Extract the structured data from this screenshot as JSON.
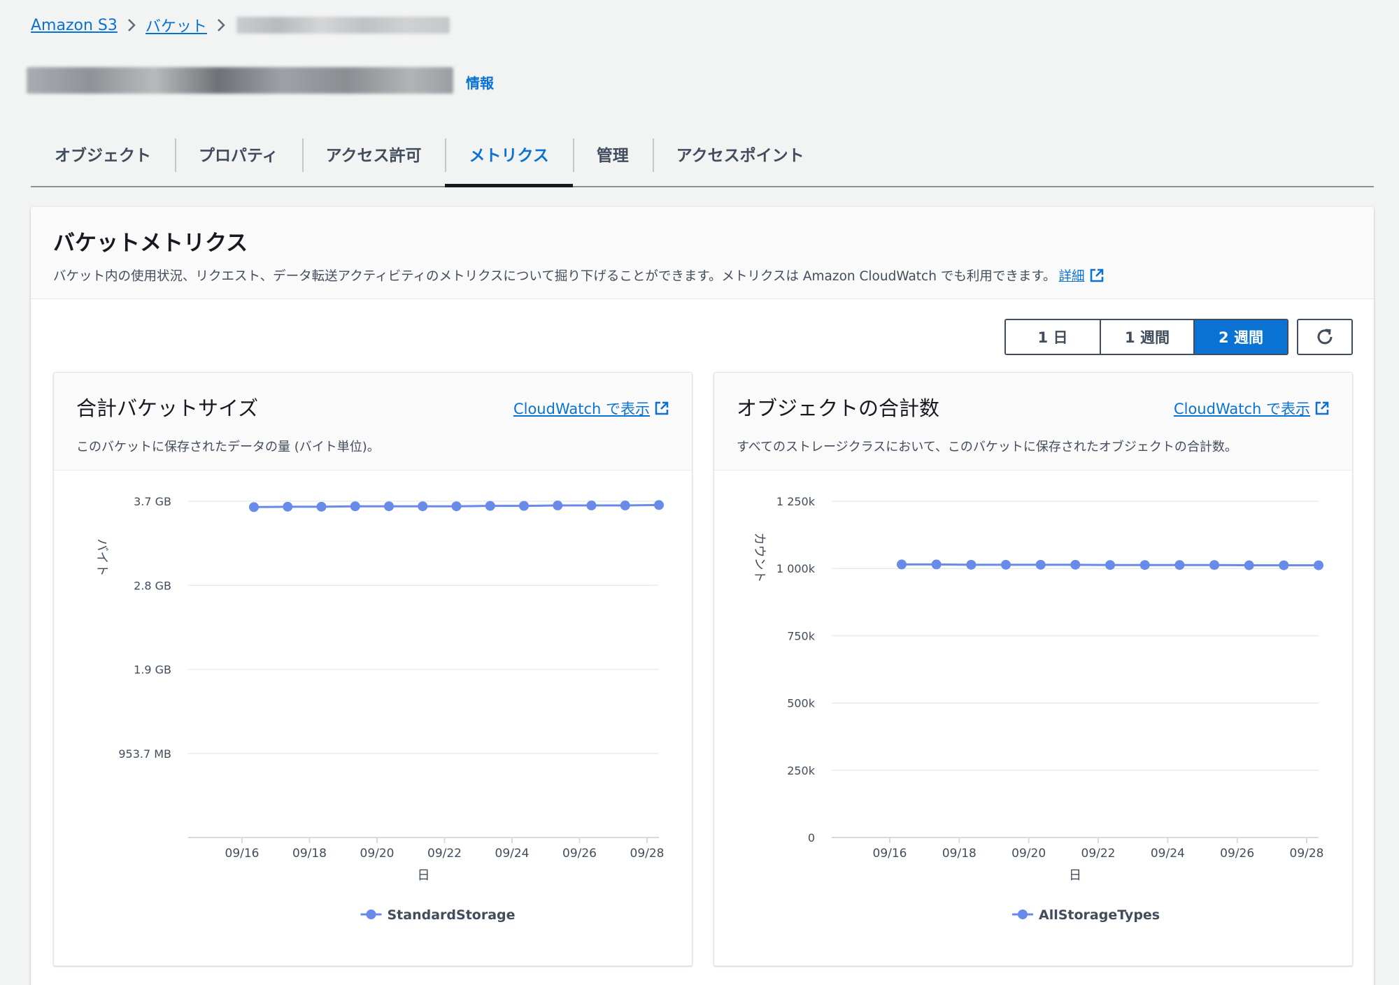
{
  "breadcrumb": {
    "root": "Amazon S3",
    "buckets": "バケット"
  },
  "header": {
    "info": "情報"
  },
  "tabs": [
    "オブジェクト",
    "プロパティ",
    "アクセス許可",
    "メトリクス",
    "管理",
    "アクセスポイント"
  ],
  "active_tab": 3,
  "section": {
    "title": "バケットメトリクス",
    "description": "バケット内の使用状況、リクエスト、データ転送アクティビティのメトリクスについて掘り下げることができます。メトリクスは Amazon CloudWatch でも利用できます。",
    "detail_link": "詳細"
  },
  "range": {
    "options": [
      "1 日",
      "1 週間",
      "2 週間"
    ],
    "selected": 2
  },
  "icons": {
    "refresh": "refresh-icon",
    "external": "external-link-icon",
    "chevron": "chevron-right-icon"
  },
  "colors": {
    "accent": "#0972d3",
    "series": "#688ae8"
  },
  "panels": {
    "left": {
      "title": "合計バケットサイズ",
      "link": "CloudWatch で表示",
      "description": "このバケットに保存されたデータの量 (バイト単位)。"
    },
    "right": {
      "title": "オブジェクトの合計数",
      "link": "CloudWatch で表示",
      "description": "すべてのストレージクラスにおいて、このバケットに保存されたオブジェクトの合計数。"
    }
  },
  "chart_data": [
    {
      "type": "line",
      "xlabel": "日",
      "ylabel": "バイト",
      "x_ticks": [
        "09/16",
        "09/18",
        "09/20",
        "09/22",
        "09/24",
        "09/26",
        "09/28"
      ],
      "y_ticks": [
        "953.7 MB",
        "1.9 GB",
        "2.8 GB",
        "3.7 GB"
      ],
      "y_tick_values": [
        1.0,
        2.0,
        3.0,
        4.0
      ],
      "ylim": [
        0,
        4.0
      ],
      "y_unit": "×10^9 bytes",
      "x": [
        "09/16",
        "09/17",
        "09/18",
        "09/19",
        "09/20",
        "09/21",
        "09/22",
        "09/23",
        "09/24",
        "09/25",
        "09/26",
        "09/27",
        "09/28"
      ],
      "series": [
        {
          "name": "StandardStorage",
          "values": [
            3.93,
            3.935,
            3.935,
            3.94,
            3.94,
            3.94,
            3.94,
            3.945,
            3.945,
            3.95,
            3.95,
            3.95,
            3.955
          ]
        }
      ],
      "legend": "bottom",
      "grid": true
    },
    {
      "type": "line",
      "xlabel": "日",
      "ylabel": "カウント",
      "x_ticks": [
        "09/16",
        "09/18",
        "09/20",
        "09/22",
        "09/24",
        "09/26",
        "09/28"
      ],
      "y_ticks": [
        "0",
        "250k",
        "500k",
        "750k",
        "1 000k",
        "1 250k"
      ],
      "y_tick_values": [
        0,
        250000,
        500000,
        750000,
        1000000,
        1250000
      ],
      "ylim": [
        0,
        1250000
      ],
      "x": [
        "09/16",
        "09/17",
        "09/18",
        "09/19",
        "09/20",
        "09/21",
        "09/22",
        "09/23",
        "09/24",
        "09/25",
        "09/26",
        "09/27",
        "09/28"
      ],
      "series": [
        {
          "name": "AllStorageTypes",
          "values": [
            1015000,
            1015000,
            1014000,
            1014000,
            1014000,
            1014000,
            1013000,
            1013000,
            1013000,
            1013000,
            1012000,
            1012000,
            1012000
          ]
        }
      ],
      "legend": "bottom",
      "grid": true
    }
  ]
}
